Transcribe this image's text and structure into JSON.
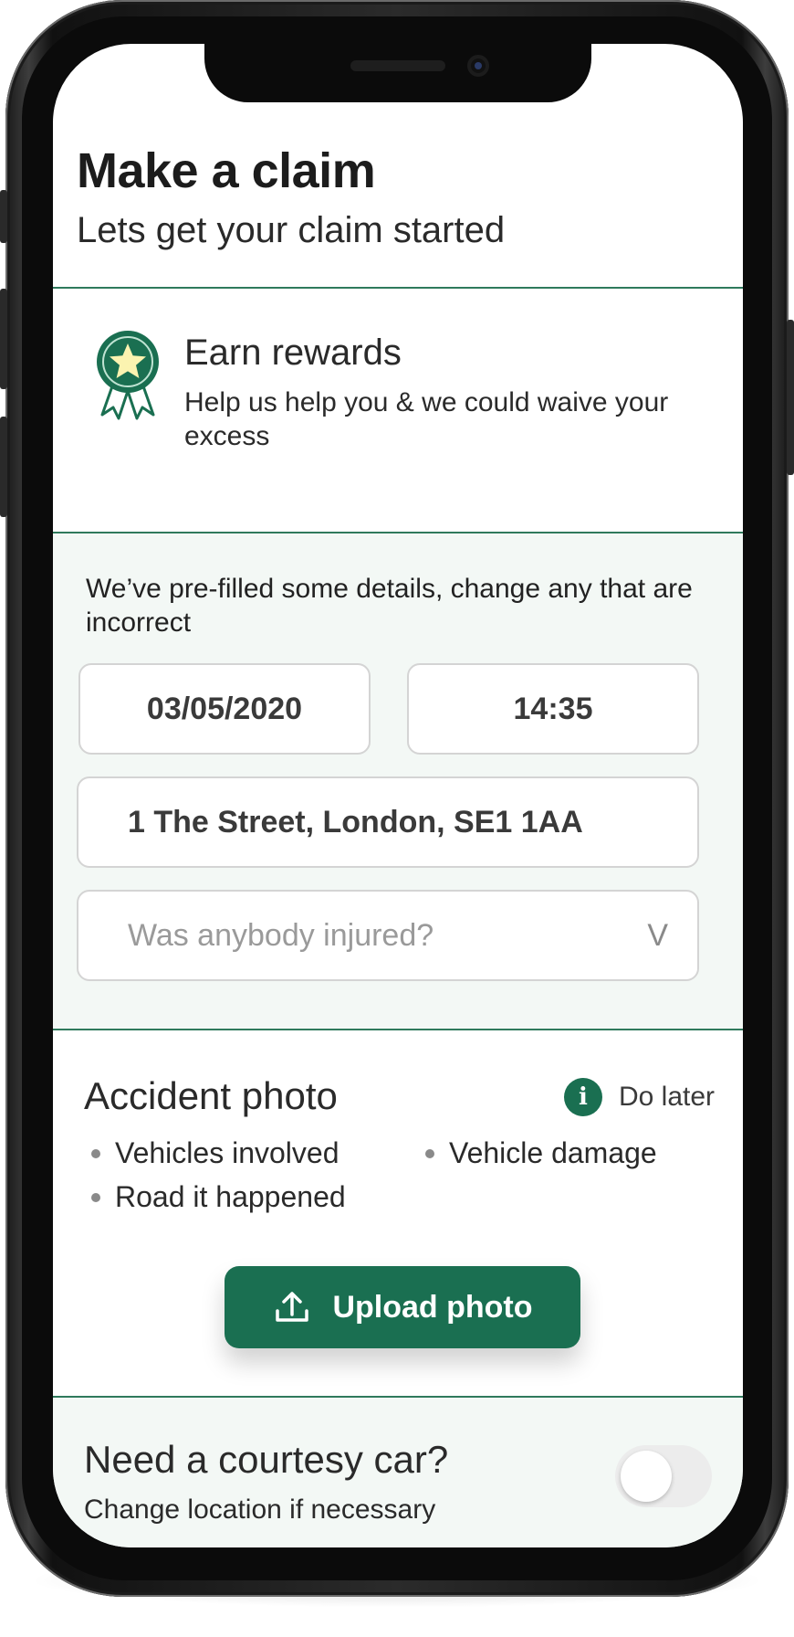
{
  "header": {
    "title": "Make a claim",
    "subtitle": "Lets get your claim started"
  },
  "rewards": {
    "icon": "award-ribbon-star-icon",
    "title": "Earn rewards",
    "text": "Help us help you & we could waive your excess"
  },
  "prefill": {
    "note": "We’ve pre-filled some details, change any that are incorrect",
    "date": "03/05/2020",
    "time": "14:35",
    "address": "1 The Street, London, SE1 1AA",
    "injured_placeholder": "Was anybody injured?",
    "injured_caret": "V"
  },
  "photo": {
    "title": "Accident photo",
    "do_later_icon": "info-icon",
    "do_later_icon_glyph": "i",
    "do_later_label": "Do later",
    "bullets": [
      "Vehicles involved",
      "Vehicle damage",
      "Road it happened"
    ],
    "upload_icon": "upload-icon",
    "upload_label": "Upload photo"
  },
  "courtesy": {
    "title": "Need a courtesy car?",
    "subtitle": "Change location if necessary",
    "toggle_on": false
  },
  "colors": {
    "brand_green": "#1a6f51",
    "divider_green": "#2f7a5c",
    "panel_tint": "#f3f8f5",
    "star_fill": "#fbf3b0"
  }
}
